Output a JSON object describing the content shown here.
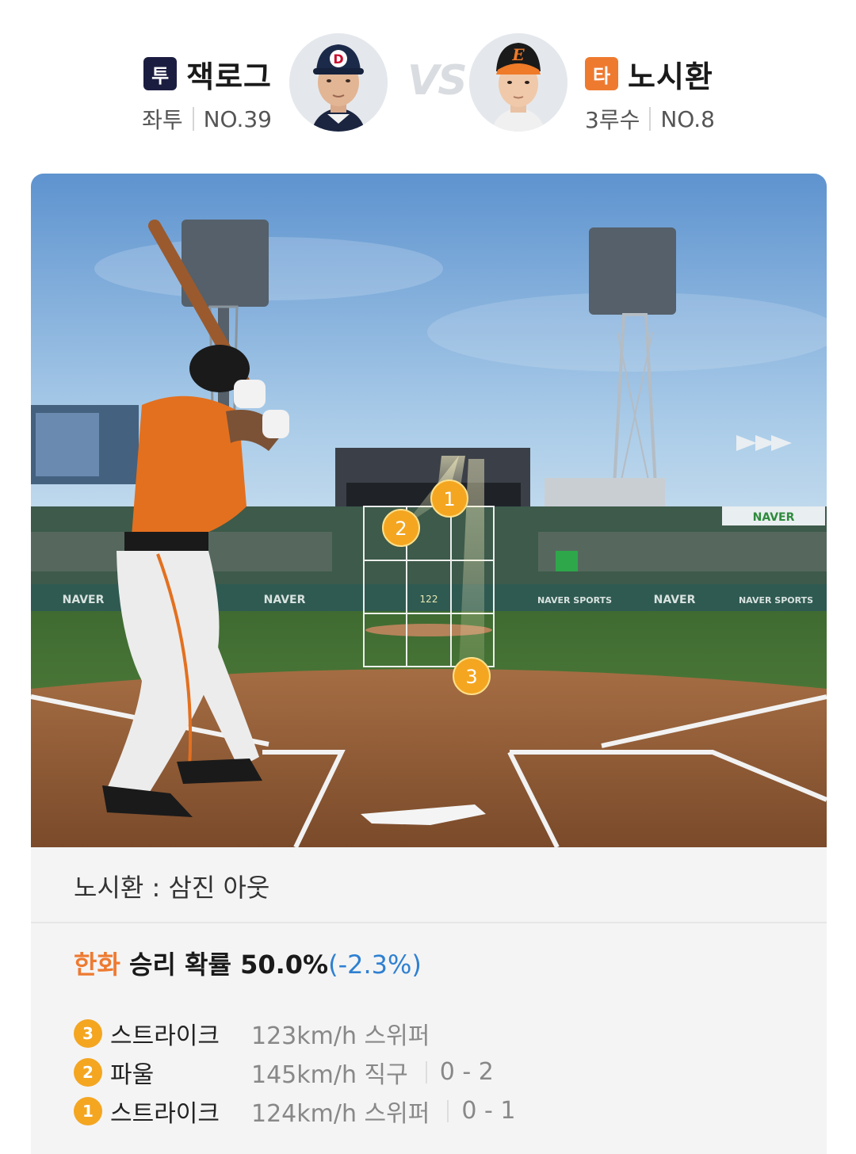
{
  "pitcher": {
    "badge": "투",
    "name": "잭로그",
    "throws": "좌투",
    "number": "NO.39",
    "cap_letter": "D"
  },
  "vs": "VS",
  "batter": {
    "badge": "타",
    "name": "노시환",
    "position": "3루수",
    "number": "NO.8",
    "cap_letter": "E"
  },
  "field": {
    "strike_zone_speed": "122",
    "ad_text": "NAVER",
    "ad_text_sports": "NAVER SPORTS",
    "pitch_markers": [
      {
        "seq": "1"
      },
      {
        "seq": "2"
      },
      {
        "seq": "3"
      }
    ]
  },
  "result": {
    "text": "노시환 : 삼진 아웃"
  },
  "win_probability": {
    "team": "한화",
    "label": "승리 확률",
    "value": "50.0%",
    "delta": "(-2.3%)"
  },
  "pitches": [
    {
      "seq": "3",
      "result": "스트라이크",
      "detail": "123km/h 스위퍼",
      "count": ""
    },
    {
      "seq": "2",
      "result": "파울",
      "detail": "145km/h 직구",
      "count": "0 - 2"
    },
    {
      "seq": "1",
      "result": "스트라이크",
      "detail": "124km/h 스위퍼",
      "count": "0 - 1"
    }
  ],
  "colors": {
    "accent_orange": "#ee7a30",
    "pitcher_badge": "#1b1d40",
    "marker_gold": "#f4a621",
    "delta_blue": "#2f80d1"
  }
}
